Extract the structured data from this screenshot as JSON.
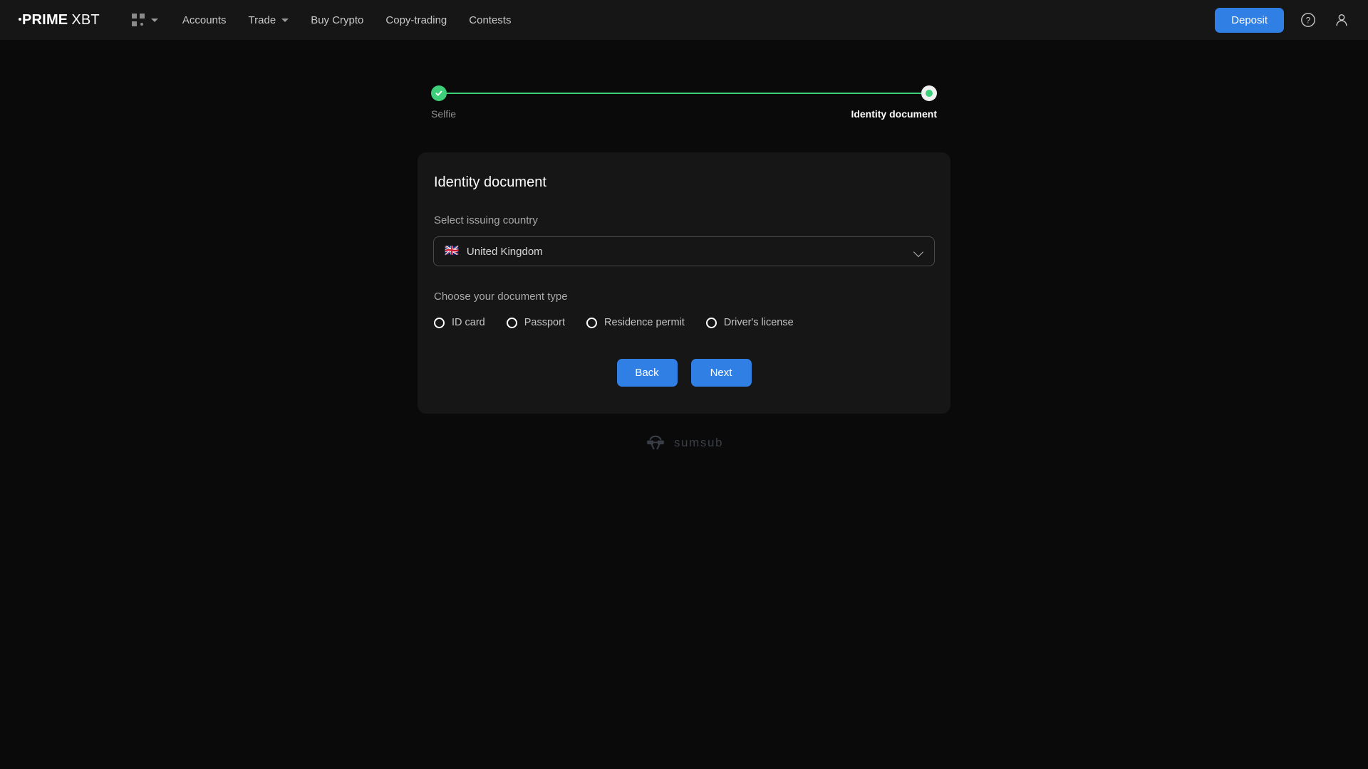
{
  "header": {
    "logo": {
      "dot": "·",
      "prime": "PRIME",
      "xbt": "XBT"
    },
    "grid_menu_icon": "grid-apps-icon",
    "nav": [
      {
        "label": "Accounts",
        "has_caret": false
      },
      {
        "label": "Trade",
        "has_caret": true
      },
      {
        "label": "Buy Crypto",
        "has_caret": false
      },
      {
        "label": "Copy-trading",
        "has_caret": false
      },
      {
        "label": "Contests",
        "has_caret": false
      }
    ],
    "deposit_label": "Deposit",
    "help_icon": "question-mark-circle-icon",
    "account_icon": "user-account-icon",
    "accent_color": "#2f7fe4",
    "background_color": "#161616"
  },
  "stepper": {
    "steps": [
      {
        "label": "Selfie",
        "state": "completed"
      },
      {
        "label": "Identity document",
        "state": "current"
      }
    ],
    "line_color": "#3ecf7a",
    "completed_color": "#3ecf7a",
    "current_ring_color": "#f0f0f0"
  },
  "card": {
    "title": "Identity document",
    "country": {
      "label": "Select issuing country",
      "flag": "🇬🇧",
      "value": "United Kingdom",
      "chevron_icon": "chevron-down-icon"
    },
    "document_type": {
      "label": "Choose your document type",
      "options": [
        {
          "label": "ID card",
          "selected": false
        },
        {
          "label": "Passport",
          "selected": false
        },
        {
          "label": "Residence permit",
          "selected": false
        },
        {
          "label": "Driver's license",
          "selected": false
        }
      ]
    },
    "buttons": {
      "back_label": "Back",
      "next_label": "Next"
    },
    "background_color": "#161616"
  },
  "footer": {
    "logo_icon": "sumsub-mask-icon",
    "brand": "sumsub",
    "color": "#3a3e46"
  },
  "page": {
    "background_color": "#0a0a0a"
  }
}
